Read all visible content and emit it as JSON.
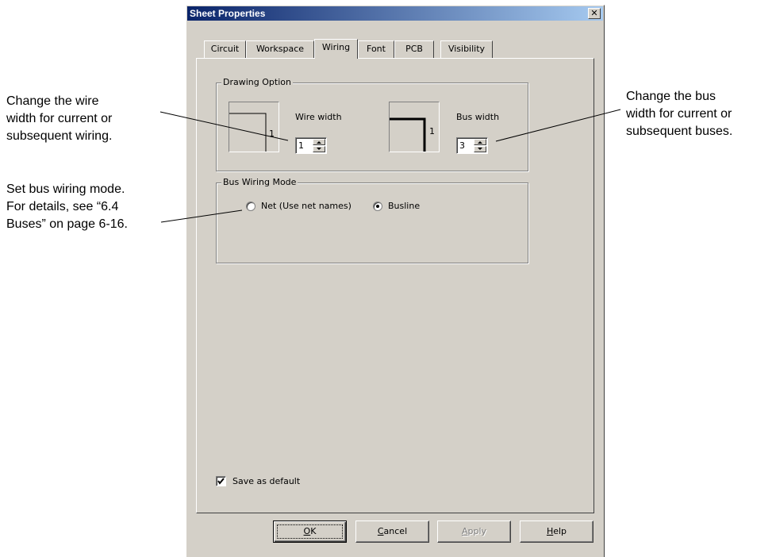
{
  "annotations": {
    "wire": [
      "Change the wire",
      "width for current or",
      "subsequent wiring."
    ],
    "bus": [
      "Change the bus",
      "width for current or",
      "subsequent buses."
    ],
    "mode": [
      "Set bus wiring mode.",
      "For details, see “6.4",
      "Buses” on page 6-16."
    ]
  },
  "dialog": {
    "title": "Sheet Properties",
    "close_glyph": "✕",
    "tabs": [
      {
        "label": "Circuit",
        "active": false
      },
      {
        "label": "Workspace",
        "active": false
      },
      {
        "label": "Wiring",
        "active": true
      },
      {
        "label": "Font",
        "active": false
      },
      {
        "label": "PCB",
        "active": false
      },
      {
        "label": "Visibility",
        "active": false
      }
    ],
    "drawing_option": {
      "label": "Drawing Option",
      "wire_width_label": "Wire width",
      "wire_width_value": "1",
      "wire_preview_number": "1",
      "bus_width_label": "Bus width",
      "bus_width_value": "3",
      "bus_preview_number": "1"
    },
    "bus_wiring_mode": {
      "label": "Bus Wiring Mode",
      "options": [
        {
          "label": "Net (Use net names)",
          "selected": false
        },
        {
          "label": "Busline",
          "selected": true
        }
      ]
    },
    "save_default": {
      "label": "Save as default",
      "checked": true
    },
    "buttons": {
      "ok": {
        "pre": "",
        "accel": "O",
        "post": "K"
      },
      "cancel": {
        "pre": "",
        "accel": "C",
        "post": "ancel"
      },
      "apply": {
        "pre": "",
        "accel": "A",
        "post": "pply",
        "disabled": true
      },
      "help": {
        "pre": "",
        "accel": "H",
        "post": "elp"
      }
    }
  },
  "colors": {
    "title_start": "#0a246a",
    "title_end": "#a6caf0",
    "face": "#d4d0c8"
  }
}
